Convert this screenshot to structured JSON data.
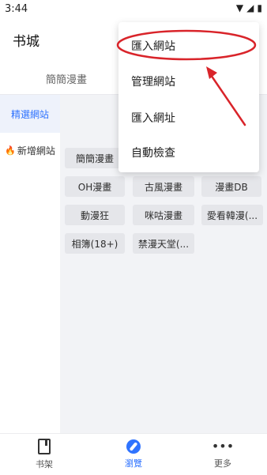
{
  "status_bar": {
    "time": "3:44",
    "icons": [
      "wifi-icon",
      "signal-icon",
      "battery-icon"
    ]
  },
  "app_bar": {
    "title": "书城"
  },
  "source_tab": {
    "label": "簡簡漫畫"
  },
  "sidebar": {
    "items": [
      {
        "label": "精選網站",
        "selected": true
      },
      {
        "label": "新增網站",
        "icon": "fire-icon",
        "selected": false
      }
    ]
  },
  "sites": [
    "簡簡漫畫",
    "OH漫畫",
    "古風漫畫",
    "漫畫DB",
    "動漫狂",
    "咪咕漫畫",
    "愛看韓漫(...",
    "相簿(18+)",
    "禁漫天堂(..."
  ],
  "menu": {
    "items": [
      "匯入網站",
      "管理網站",
      "匯入網址",
      "自動檢查"
    ],
    "highlighted_index": 0
  },
  "bottom_nav": {
    "items": [
      {
        "label": "书架",
        "icon": "bookshelf-icon",
        "active": false
      },
      {
        "label": "瀏覽",
        "icon": "compass-icon",
        "active": true
      },
      {
        "label": "更多",
        "icon": "more-dots-icon",
        "active": false
      }
    ]
  },
  "colors": {
    "accent": "#2f73ff",
    "annotation": "#d9242a",
    "chip_bg": "#e5e6ea",
    "content_bg": "#f2f3f6"
  }
}
